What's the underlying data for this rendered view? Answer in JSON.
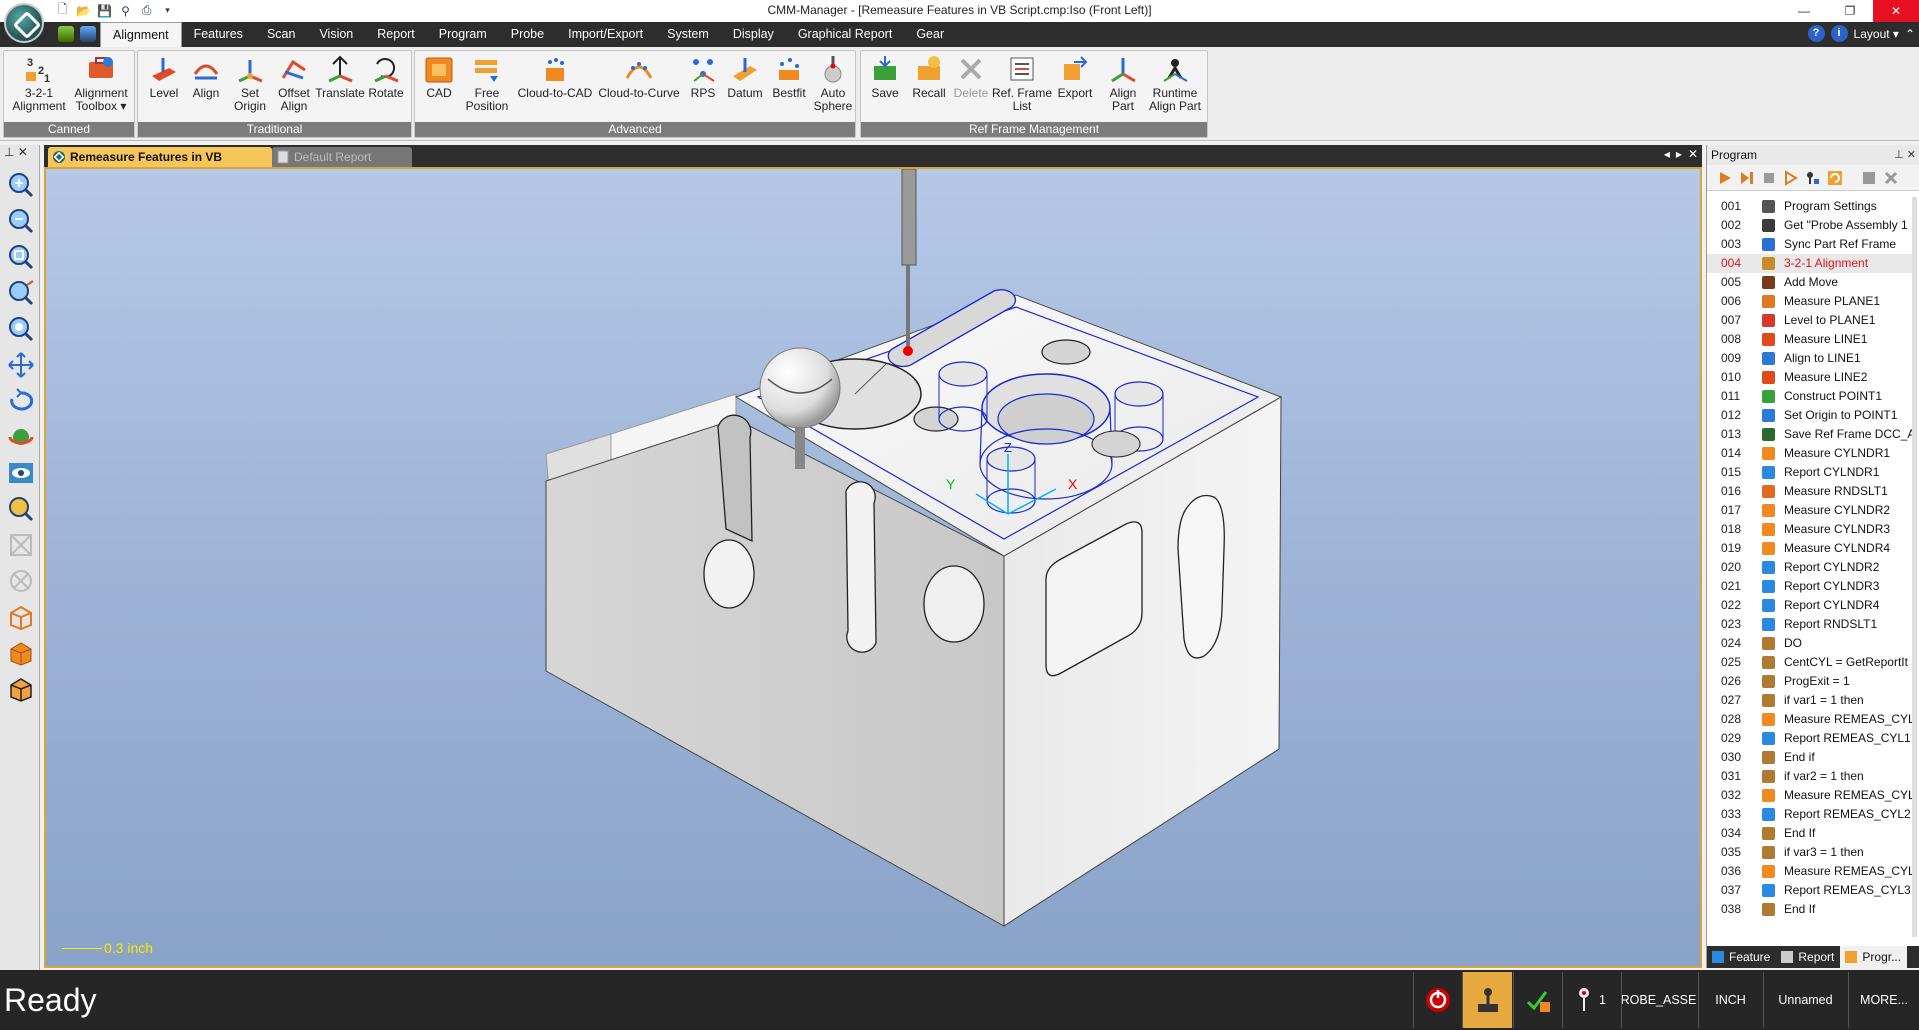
{
  "window": {
    "title": "CMM-Manager - [Remeasure Features in VB Script.cmp:Iso (Front Left)]",
    "minimize": "—",
    "restore": "❐",
    "close": "✕"
  },
  "tabs": [
    {
      "label": "Alignment",
      "active": true
    },
    {
      "label": "Features"
    },
    {
      "label": "Scan"
    },
    {
      "label": "Vision"
    },
    {
      "label": "Report"
    },
    {
      "label": "Program"
    },
    {
      "label": "Probe"
    },
    {
      "label": "Import/Export"
    },
    {
      "label": "System"
    },
    {
      "label": "Display"
    },
    {
      "label": "Graphical Report"
    },
    {
      "label": "Gear"
    }
  ],
  "layout_menu": "Layout",
  "ribbon": {
    "groups": [
      {
        "label": "Canned",
        "buttons": [
          {
            "label1": "3-2-1",
            "label2": "Alignment",
            "icon": "alignment-321-icon"
          },
          {
            "label1": "Alignment",
            "label2": "Toolbox ▾",
            "icon": "alignment-toolbox-icon"
          }
        ]
      },
      {
        "label": "Traditional",
        "buttons": [
          {
            "label1": "Level",
            "label2": "",
            "icon": "level-icon"
          },
          {
            "label1": "Align",
            "label2": "",
            "icon": "align-icon"
          },
          {
            "label1": "Set",
            "label2": "Origin",
            "icon": "set-origin-icon"
          },
          {
            "label1": "Offset",
            "label2": "Align",
            "icon": "offset-align-icon"
          },
          {
            "label1": "Translate",
            "label2": "",
            "icon": "translate-icon"
          },
          {
            "label1": "Rotate",
            "label2": "",
            "icon": "rotate-icon"
          }
        ]
      },
      {
        "label": "Advanced",
        "buttons": [
          {
            "label1": "CAD",
            "label2": "",
            "icon": "cad-icon"
          },
          {
            "label1": "Free",
            "label2": "Position",
            "icon": "free-position-icon"
          },
          {
            "label1": "Cloud-to-CAD",
            "label2": "",
            "icon": "cloud-to-cad-icon"
          },
          {
            "label1": "Cloud-to-Curve",
            "label2": "",
            "icon": "cloud-to-curve-icon"
          },
          {
            "label1": "RPS",
            "label2": "",
            "icon": "rps-icon"
          },
          {
            "label1": "Datum",
            "label2": "",
            "icon": "datum-icon"
          },
          {
            "label1": "Bestfit",
            "label2": "",
            "icon": "bestfit-icon"
          },
          {
            "label1": "Auto",
            "label2": "Sphere",
            "icon": "auto-sphere-icon"
          }
        ]
      },
      {
        "label": "Ref Frame Management",
        "buttons": [
          {
            "label1": "Save",
            "label2": "",
            "icon": "save-icon"
          },
          {
            "label1": "Recall",
            "label2": "",
            "icon": "recall-icon"
          },
          {
            "label1": "Delete",
            "label2": "",
            "icon": "delete-icon",
            "disabled": true
          },
          {
            "label1": "Ref. Frame",
            "label2": "List",
            "icon": "ref-frame-list-icon"
          },
          {
            "label1": "Export",
            "label2": "",
            "icon": "export-icon"
          },
          {
            "label1": "Align",
            "label2": "Part",
            "icon": "align-part-icon"
          },
          {
            "label1": "Runtime",
            "label2": "Align Part",
            "icon": "runtime-align-part-icon"
          }
        ]
      }
    ]
  },
  "doc_tabs": {
    "active": "Remeasure Features in VB Script...",
    "inactive": "Default Report"
  },
  "viewport": {
    "scale_label": "0.3 inch",
    "axis_labels": {
      "x": "X",
      "y": "Y",
      "z": "Z"
    }
  },
  "program_panel": {
    "title": "Program",
    "selected_index": 3,
    "steps": [
      {
        "num": "001",
        "text": "Program Settings",
        "color": "#555555"
      },
      {
        "num": "002",
        "text": "Get \"Probe Assembly 1",
        "color": "#3c3c3c"
      },
      {
        "num": "003",
        "text": "Sync Part Ref Frame",
        "color": "#2a6fd6"
      },
      {
        "num": "004",
        "text": "3-2-1 Alignment",
        "color": "#c88a2a"
      },
      {
        "num": "005",
        "text": "Add Move",
        "color": "#7a3b1a"
      },
      {
        "num": "006",
        "text": "Measure PLANE1",
        "color": "#e07a20"
      },
      {
        "num": "007",
        "text": "Level to PLANE1",
        "color": "#d23a2a"
      },
      {
        "num": "008",
        "text": "Measure LINE1",
        "color": "#e04a1a"
      },
      {
        "num": "009",
        "text": "Align to LINE1",
        "color": "#2a7ad6"
      },
      {
        "num": "010",
        "text": "Measure LINE2",
        "color": "#e04a1a"
      },
      {
        "num": "011",
        "text": "Construct POINT1",
        "color": "#3aa03a"
      },
      {
        "num": "012",
        "text": "Set Origin to POINT1",
        "color": "#2a7ad6"
      },
      {
        "num": "013",
        "text": "Save Ref Frame DCC_A",
        "color": "#2a6a2a"
      },
      {
        "num": "014",
        "text": "Measure CYLNDR1",
        "color": "#f08a20"
      },
      {
        "num": "015",
        "text": "Report CYLNDR1",
        "color": "#2a8ae0"
      },
      {
        "num": "016",
        "text": "Measure RNDSLT1",
        "color": "#e06a20"
      },
      {
        "num": "017",
        "text": "Measure CYLNDR2",
        "color": "#f08a20"
      },
      {
        "num": "018",
        "text": "Measure CYLNDR3",
        "color": "#f08a20"
      },
      {
        "num": "019",
        "text": "Measure CYLNDR4",
        "color": "#f08a20"
      },
      {
        "num": "020",
        "text": "Report CYLNDR2",
        "color": "#2a8ae0"
      },
      {
        "num": "021",
        "text": "Report CYLNDR3",
        "color": "#2a8ae0"
      },
      {
        "num": "022",
        "text": "Report CYLNDR4",
        "color": "#2a8ae0"
      },
      {
        "num": "023",
        "text": "Report RNDSLT1",
        "color": "#2a8ae0"
      },
      {
        "num": "024",
        "text": "DO",
        "color": "#b07a30"
      },
      {
        "num": "025",
        "text": "CentCYL = GetReportIt",
        "color": "#b07a30"
      },
      {
        "num": "026",
        "text": "ProgExit = 1",
        "color": "#b07a30"
      },
      {
        "num": "027",
        "text": "if var1 = 1 then",
        "color": "#b07a30"
      },
      {
        "num": "028",
        "text": "Measure REMEAS_CYL",
        "color": "#f08a20"
      },
      {
        "num": "029",
        "text": "Report REMEAS_CYL1",
        "color": "#2a8ae0"
      },
      {
        "num": "030",
        "text": "End if",
        "color": "#b07a30"
      },
      {
        "num": "031",
        "text": "if var2 = 1 then",
        "color": "#b07a30"
      },
      {
        "num": "032",
        "text": "Measure REMEAS_CYL",
        "color": "#f08a20"
      },
      {
        "num": "033",
        "text": "Report REMEAS_CYL2",
        "color": "#2a8ae0"
      },
      {
        "num": "034",
        "text": "End If",
        "color": "#b07a30"
      },
      {
        "num": "035",
        "text": "if var3 = 1 then",
        "color": "#b07a30"
      },
      {
        "num": "036",
        "text": "Measure REMEAS_CYL",
        "color": "#f08a20"
      },
      {
        "num": "037",
        "text": "Report REMEAS_CYL3",
        "color": "#2a8ae0"
      },
      {
        "num": "038",
        "text": "End If",
        "color": "#b07a30"
      }
    ],
    "bottom_tabs": [
      {
        "label": "Feature"
      },
      {
        "label": "Report"
      },
      {
        "label": "Progr...",
        "active": true
      }
    ]
  },
  "statusbar": {
    "status": "Ready",
    "probe_count": "1",
    "probe_name": "PROBE_ASSEM",
    "units": "INCH",
    "ref_frame": "Unnamed",
    "more": "MORE..."
  },
  "colors": {
    "accent_orange": "#f6c65a",
    "selected_step": "#e0141a",
    "viewport_top": "#b5c8e6",
    "viewport_bottom": "#8aa3c8"
  }
}
